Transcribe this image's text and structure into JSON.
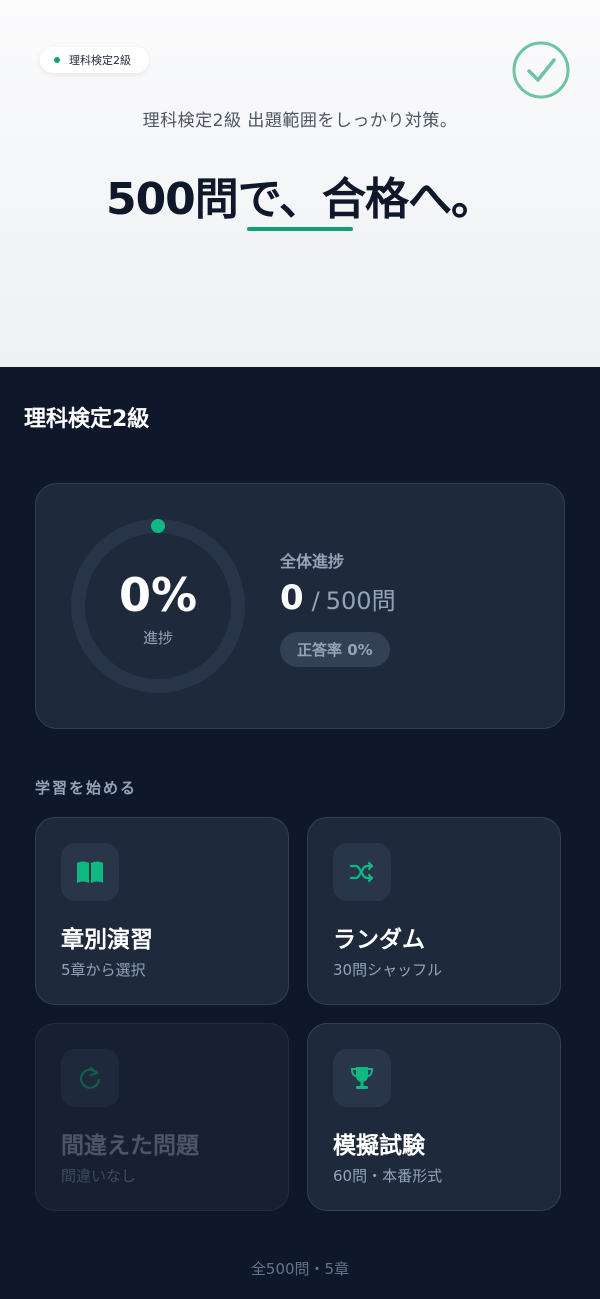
{
  "hero": {
    "tag": "理科検定2級",
    "subtitle": "理科検定2級 出題範囲をしっかり対策。",
    "headline": "500問で、合格へ。",
    "accent": "#10a36f"
  },
  "section": {
    "title": "理科検定2級"
  },
  "progress": {
    "percent_text": "0%",
    "percent_value": 0,
    "ring_label": "進捗",
    "overall_label": "全体進捗",
    "answered": "0",
    "slash": "/",
    "total": "500問",
    "accuracy": "正答率 0%"
  },
  "start": {
    "label": "学習を始める",
    "modes": [
      {
        "title": "章別演習",
        "subtitle": "5章から選択",
        "icon": "book-open-icon",
        "enabled": true
      },
      {
        "title": "ランダム",
        "subtitle": "30問シャッフル",
        "icon": "shuffle-icon",
        "enabled": true
      },
      {
        "title": "間違えた問題",
        "subtitle": "間違いなし",
        "icon": "refresh-icon",
        "enabled": false
      },
      {
        "title": "模擬試験",
        "subtitle": "60問・本番形式",
        "icon": "trophy-icon",
        "enabled": true
      }
    ]
  },
  "footer": "全500問・5章",
  "colors": {
    "dark_bg": "#0f172a",
    "card_bg": "#1e293b",
    "accent": "#10a36f"
  }
}
